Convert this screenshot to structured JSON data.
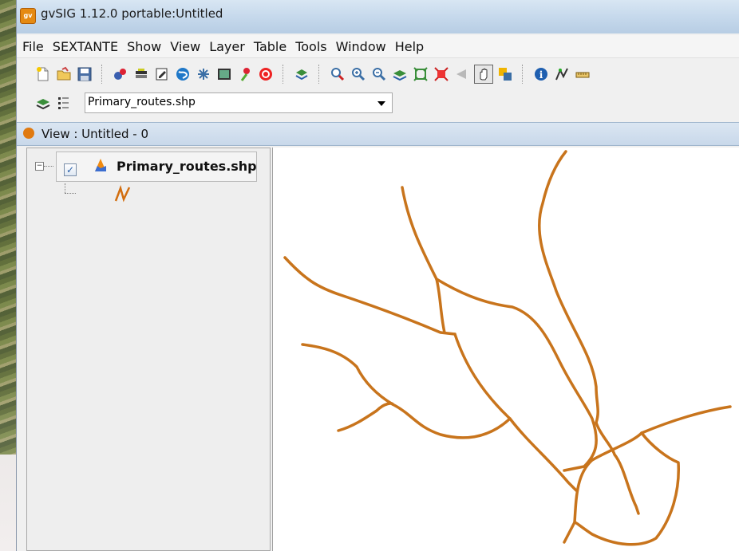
{
  "window": {
    "title": "gvSIG 1.12.0 portable:Untitled",
    "app_icon": "gvsig-icon"
  },
  "menubar": {
    "items": [
      "File",
      "SEXTANTE",
      "Show",
      "View",
      "Layer",
      "Table",
      "Tools",
      "Window",
      "Help"
    ]
  },
  "toolbar1": {
    "icons": [
      "new-document-icon",
      "open-folder-icon",
      "save-icon",
      "add-layer-icon",
      "layer-stack-icon",
      "edit-icon",
      "globe-icon",
      "network-icon",
      "console-icon",
      "pin-icon",
      "target-icon",
      "add-view-icon",
      "zoom-select-icon",
      "zoom-in-icon",
      "zoom-out-icon",
      "zoom-layer-icon",
      "zoom-full-icon",
      "zoom-extent-icon",
      "back-icon",
      "pan-hand-icon",
      "select-icon",
      "info-icon",
      "measure-icon",
      "ruler-icon"
    ]
  },
  "toolbar2": {
    "icons": [
      "layer-manager-icon",
      "legend-icon"
    ],
    "layer_select": {
      "value": "Primary_routes.shp"
    }
  },
  "view": {
    "title": "View : Untitled - 0"
  },
  "toc": {
    "layers": [
      {
        "name": "Primary_routes.shp",
        "checked": true,
        "symbol": "line-symbol-icon",
        "color": "#c8741c"
      }
    ]
  },
  "colors": {
    "route": "#c8741c",
    "titlebar": "#c6d9ec",
    "map_bg": "#ffffff"
  }
}
